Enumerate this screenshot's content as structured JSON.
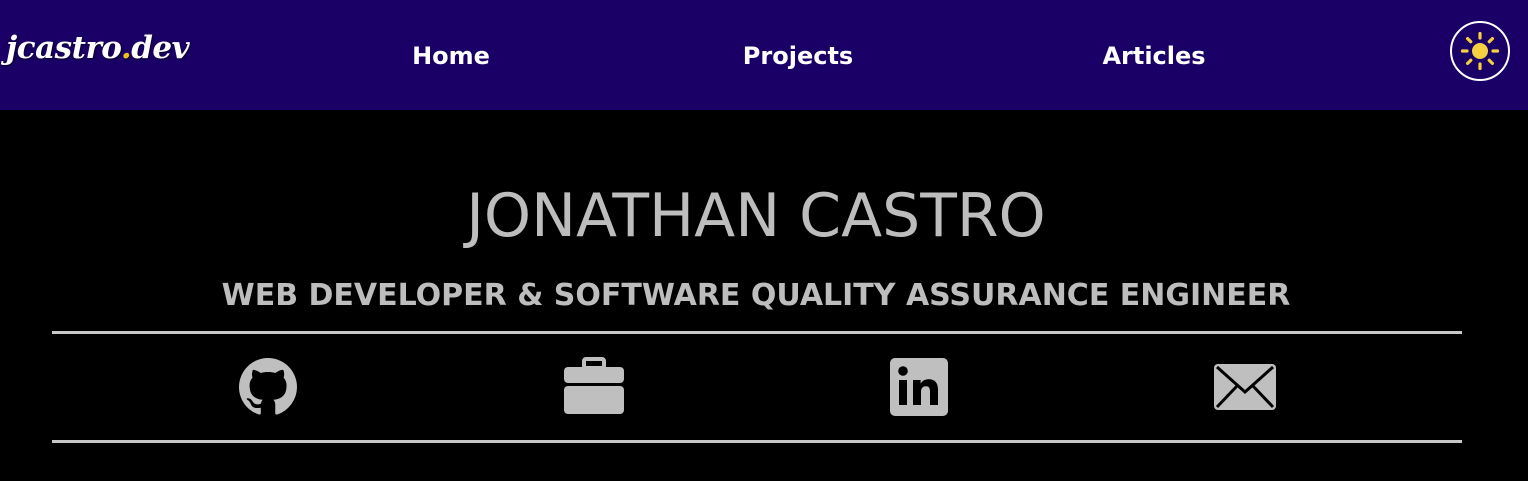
{
  "header": {
    "logo": {
      "main": "jcastro",
      "dot": ".",
      "tld": "dev"
    },
    "nav": [
      {
        "label": "Home"
      },
      {
        "label": "Projects"
      },
      {
        "label": "Articles"
      }
    ],
    "theme_toggle_icon": "sun-icon"
  },
  "hero": {
    "name": "JONATHAN CASTRO",
    "subtitle": "WEB DEVELOPER & SOFTWARE QUALITY ASSURANCE ENGINEER"
  },
  "social_links": [
    {
      "icon": "github-icon"
    },
    {
      "icon": "briefcase-icon"
    },
    {
      "icon": "linkedin-icon"
    },
    {
      "icon": "envelope-icon"
    }
  ],
  "colors": {
    "nav_background": "#1a0066",
    "page_background": "#000000",
    "text_light": "#bdbdbd",
    "icon_gray": "#bfbfbf",
    "sun_yellow": "#f5d142",
    "logo_dot": "#f0c020"
  }
}
